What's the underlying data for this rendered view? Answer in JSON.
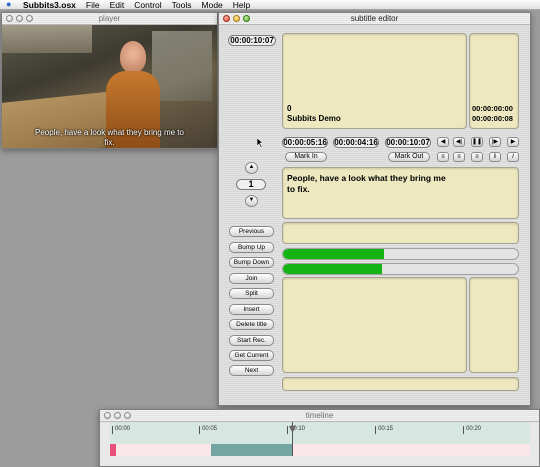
{
  "menubar": {
    "app_name": "Subbits3.osx",
    "items": [
      "File",
      "Edit",
      "Control",
      "Tools",
      "Mode",
      "Help"
    ]
  },
  "player": {
    "title": "player",
    "subtitle_line1": "People, have a look what they bring me to",
    "subtitle_line2": "fix."
  },
  "editor": {
    "title": "subtitle editor",
    "current_time": "00:00:10:07",
    "info_index": "0",
    "info_name": "Subbits Demo",
    "info_time1": "00:00:00:00",
    "info_time2": "00:00:00:08",
    "mark_in_time": "00:00:05:16",
    "duration_time": "00:00:04:16",
    "mark_out_time": "00:00:10:07",
    "mark_in_label": "Mark In",
    "mark_out_label": "Mark Out",
    "title_number": "1",
    "subtitle_text_line1": "People, have a look what they bring me",
    "subtitle_text_line2": "to fix.",
    "progress1": 0.43,
    "progress2": 0.42,
    "side_buttons": [
      "Previous",
      "Bump Up",
      "Bump Down",
      "Join",
      "Split",
      "Insert",
      "Delete title",
      "Start Rec.",
      "Get Current",
      "Next"
    ]
  },
  "timeline": {
    "title": "timeline",
    "ticks": [
      "00:00",
      "00:05",
      "00:10",
      "00:15",
      "00:20"
    ]
  },
  "colors": {
    "panel": "#ede8c0",
    "progress": "#13b413",
    "timeline_block": "#74a5a0",
    "timeline_marker": "#e8507c"
  }
}
